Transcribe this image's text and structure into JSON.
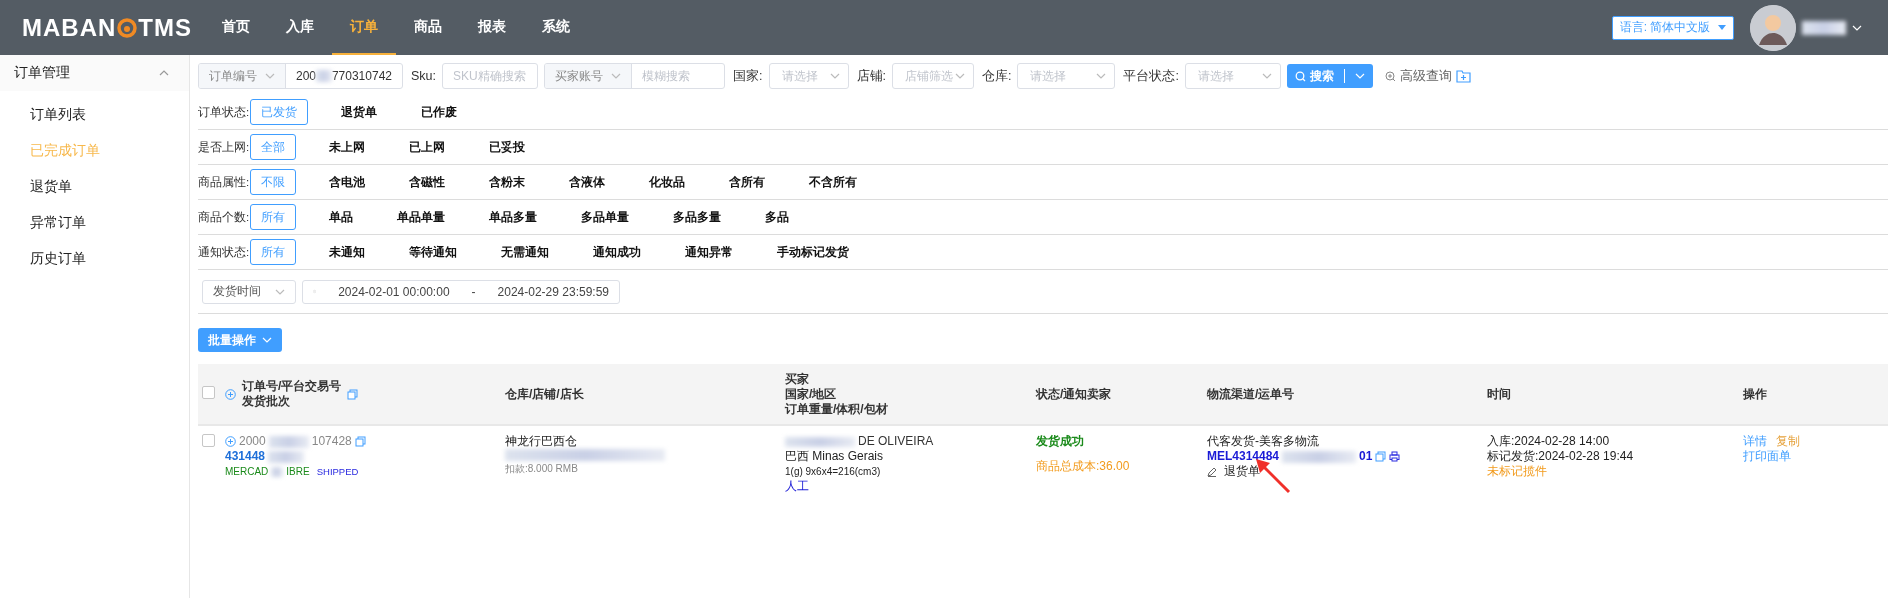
{
  "header": {
    "logo_left": "MABAN",
    "logo_right": "TMS",
    "nav": [
      {
        "label": "首页",
        "selected": false
      },
      {
        "label": "入库",
        "selected": false
      },
      {
        "label": "订单",
        "selected": true
      },
      {
        "label": "商品",
        "selected": false
      },
      {
        "label": "报表",
        "selected": false
      },
      {
        "label": "系统",
        "selected": false
      }
    ],
    "language_button": "语言: 简体中文版"
  },
  "sidebar": {
    "title": "订单管理",
    "expanded": true,
    "items": [
      {
        "label": "订单列表",
        "selected": false
      },
      {
        "label": "已完成订单",
        "selected": true
      },
      {
        "label": "退货单",
        "selected": false
      },
      {
        "label": "异常订单",
        "selected": false
      },
      {
        "label": "历史订单",
        "selected": false
      }
    ]
  },
  "search": {
    "order_field": {
      "type_label": "订单编号",
      "value_start": "200",
      "value_end": "770310742"
    },
    "sku": {
      "label": "Sku:",
      "placeholder": "SKU精确搜索"
    },
    "buyer": {
      "type_label": "买家账号",
      "placeholder": "模糊搜索"
    },
    "selects": [
      {
        "label": "国家:",
        "placeholder": "请选择"
      },
      {
        "label": "店铺:",
        "placeholder": "店铺筛选"
      },
      {
        "label": "仓库:",
        "placeholder": "请选择"
      },
      {
        "label": "平台状态:",
        "placeholder": "请选择"
      }
    ],
    "search_button": "搜索",
    "advanced": "高级查询"
  },
  "filters": [
    {
      "label": "订单状态:",
      "options": [
        {
          "label": "已发货",
          "selected": true
        },
        {
          "label": "退货单",
          "selected": false
        },
        {
          "label": "已作废",
          "selected": false
        }
      ]
    },
    {
      "label": "是否上网:",
      "options": [
        {
          "label": "全部",
          "selected": true
        },
        {
          "label": "未上网",
          "selected": false
        },
        {
          "label": "已上网",
          "selected": false
        },
        {
          "label": "已妥投",
          "selected": false
        }
      ]
    },
    {
      "label": "商品属性:",
      "options": [
        {
          "label": "不限",
          "selected": true
        },
        {
          "label": "含电池",
          "selected": false
        },
        {
          "label": "含磁性",
          "selected": false
        },
        {
          "label": "含粉末",
          "selected": false
        },
        {
          "label": "含液体",
          "selected": false
        },
        {
          "label": "化妆品",
          "selected": false
        },
        {
          "label": "含所有",
          "selected": false
        },
        {
          "label": "不含所有",
          "selected": false
        }
      ]
    },
    {
      "label": "商品个数:",
      "options": [
        {
          "label": "所有",
          "selected": true
        },
        {
          "label": "单品",
          "selected": false
        },
        {
          "label": "单品单量",
          "selected": false
        },
        {
          "label": "单品多量",
          "selected": false
        },
        {
          "label": "多品单量",
          "selected": false
        },
        {
          "label": "多品多量",
          "selected": false
        },
        {
          "label": "多品",
          "selected": false
        }
      ]
    },
    {
      "label": "通知状态:",
      "options": [
        {
          "label": "所有",
          "selected": true
        },
        {
          "label": "未通知",
          "selected": false
        },
        {
          "label": "等待通知",
          "selected": false
        },
        {
          "label": "无需通知",
          "selected": false
        },
        {
          "label": "通知成功",
          "selected": false
        },
        {
          "label": "通知异常",
          "selected": false
        },
        {
          "label": "手动标记发货",
          "selected": false
        }
      ]
    }
  ],
  "date_filter": {
    "type_label": "发货时间",
    "start": "2024-02-01 00:00:00",
    "separator": "-",
    "end": "2024-02-29 23:59:59"
  },
  "batch_button": "批量操作",
  "table": {
    "all_checked": false,
    "columns": [
      {
        "lines": [
          "订单号/平台交易号",
          "发货批次"
        ]
      },
      {
        "lines": [
          "仓库/店铺/店长"
        ]
      },
      {
        "lines": [
          "买家",
          "国家/地区",
          "订单重量/体积/包材"
        ]
      },
      {
        "lines": [
          "状态/通知卖家"
        ]
      },
      {
        "lines": [
          "物流渠道/运单号"
        ]
      },
      {
        "lines": [
          "时间"
        ]
      },
      {
        "lines": [
          "操作"
        ]
      }
    ],
    "rows": [
      {
        "checked": false,
        "order_no_start": "2000",
        "order_no_end": "107428",
        "trade_no": "431448",
        "platform_start": "MERCAD",
        "platform_end": "IBRE",
        "platform_status": "SHIPPED",
        "warehouse": "神龙行巴西仓",
        "charge": "扣款:8.000 RMB",
        "buyer_name": "DE OLIVEIRA",
        "region": "巴西 Minas Gerais",
        "weight": "1(g) 9x6x4=216(cm3)",
        "packaging": "人工",
        "status": "发货成功",
        "cost": "商品总成本:36.00",
        "channel": "代客发货-美客多物流",
        "tracking_start": "MEL4314484",
        "tracking_end": "01",
        "return_tag": "退货单",
        "inbound": "入库:2024-02-28 14:00",
        "marked": "标记发货:2024-02-28 19:44",
        "pickup": "未标记揽件",
        "actions": [
          {
            "label": "详情",
            "kind": "primary"
          },
          {
            "label": "复制",
            "kind": "warning"
          },
          {
            "label": "打印面单",
            "kind": "primary"
          }
        ]
      }
    ]
  }
}
